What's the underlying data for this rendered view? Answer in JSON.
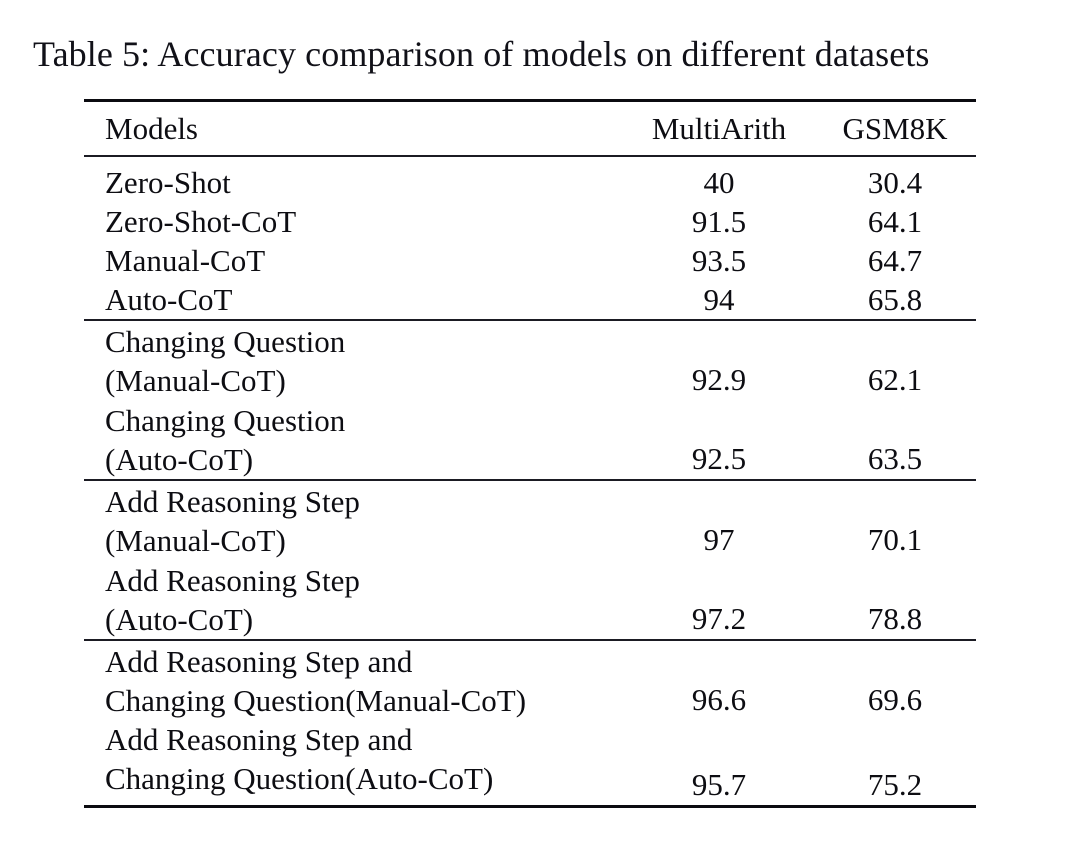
{
  "caption": {
    "label": "Table 5:",
    "text": "Table 5: Accuracy comparison of models on different datasets"
  },
  "table": {
    "columns": [
      "Models",
      "MultiArith",
      "GSM8K"
    ],
    "column_headers": {
      "models": "Models",
      "multiarith": "MultiArith",
      "gsm8k": "GSM8K"
    },
    "blocks": [
      {
        "rows": [
          {
            "label_line1": "Zero-Shot",
            "label_line2": "",
            "multiarith": "40",
            "gsm8k": "30.4"
          },
          {
            "label_line1": "Zero-Shot-CoT",
            "label_line2": "",
            "multiarith": "91.5",
            "gsm8k": "64.1"
          },
          {
            "label_line1": "Manual-CoT",
            "label_line2": "",
            "multiarith": "93.5",
            "gsm8k": "64.7"
          },
          {
            "label_line1": "Auto-CoT",
            "label_line2": "",
            "multiarith": "94",
            "gsm8k": "65.8"
          }
        ]
      },
      {
        "rows": [
          {
            "label_line1": "Changing Question",
            "label_line2": "(Manual-CoT)",
            "multiarith": "92.9",
            "gsm8k": "62.1"
          },
          {
            "label_line1": "Changing Question",
            "label_line2": "(Auto-CoT)",
            "multiarith": "92.5",
            "gsm8k": "63.5"
          }
        ]
      },
      {
        "rows": [
          {
            "label_line1": "Add Reasoning Step",
            "label_line2": "(Manual-CoT)",
            "multiarith": "97",
            "gsm8k": "70.1"
          },
          {
            "label_line1": "Add Reasoning Step",
            "label_line2": "(Auto-CoT)",
            "multiarith": "97.2",
            "gsm8k": "78.8"
          }
        ]
      },
      {
        "rows": [
          {
            "label_line1": "Add Reasoning Step and",
            "label_line2": "Changing Question(Manual-CoT)",
            "multiarith": "96.6",
            "gsm8k": "69.6"
          },
          {
            "label_line1": "Add Reasoning Step and",
            "label_line2": "Changing Question(Auto-CoT)",
            "multiarith": "95.7",
            "gsm8k": "75.2"
          }
        ]
      }
    ]
  },
  "colors": {
    "background": "#ffffff",
    "text": "#111118",
    "rule": "#0b0b10"
  }
}
